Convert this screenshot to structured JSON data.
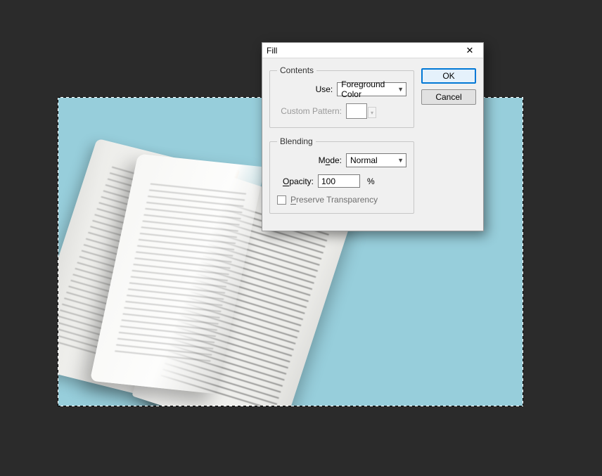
{
  "dialog": {
    "title": "Fill",
    "ok_label": "OK",
    "cancel_label": "Cancel"
  },
  "contents": {
    "legend": "Contents",
    "use_label": "Use:",
    "use_value": "Foreground Color",
    "pattern_label": "Custom Pattern:"
  },
  "blending": {
    "legend": "Blending",
    "mode_label_pre": "M",
    "mode_label_hot": "o",
    "mode_label_post": "de:",
    "mode_value": "Normal",
    "opacity_label_hot": "O",
    "opacity_label_post": "pacity:",
    "opacity_value": "100",
    "opacity_unit": "%",
    "preserve_hot": "P",
    "preserve_rest": "reserve Transparency"
  }
}
